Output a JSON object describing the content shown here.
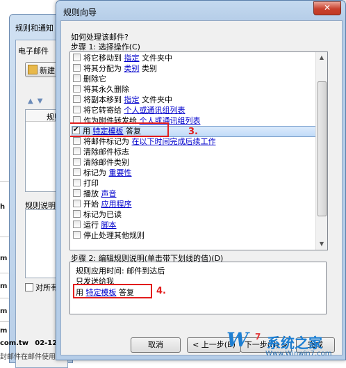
{
  "background_window": {
    "title": "规则和通知",
    "tab": "电子邮件",
    "new_button": "新建",
    "column_header": "规则",
    "description_label": "规则说明",
    "apply_all_folders": "对所有",
    "left_edge_rows": [
      "h",
      "m",
      "m",
      "m",
      "m"
    ],
    "footer_domain": "com.tw",
    "footer_time": "02-12",
    "footer_sub": "封邮件在邮件使用..."
  },
  "dialog": {
    "title": "规则向导",
    "close_glyph": "✕",
    "question": "如何处理该邮件?",
    "step1_label": "步骤 1: 选择操作(C)",
    "actions": [
      {
        "pre": "将它移动到",
        "link": "指定",
        "post": "文件夹中",
        "checked": false
      },
      {
        "pre": "将其分配为",
        "link": "类别",
        "post": "类别",
        "checked": false
      },
      {
        "pre": "删除它",
        "link": "",
        "post": "",
        "checked": false
      },
      {
        "pre": "将其永久删除",
        "link": "",
        "post": "",
        "checked": false
      },
      {
        "pre": "将副本移到",
        "link": "指定",
        "post": "文件夹中",
        "checked": false
      },
      {
        "pre": "将它转寄给",
        "link": "个人或通讯组列表",
        "post": "",
        "checked": false
      },
      {
        "pre": "作为附件转发给",
        "link": "个人或通讯组列表",
        "post": "",
        "checked": false
      },
      {
        "pre": "用",
        "link": "特定模板",
        "post": "答复",
        "checked": true
      },
      {
        "pre": "将邮件标记为",
        "link": "在以下时间完成后续工作",
        "post": "",
        "checked": false
      },
      {
        "pre": "清除邮件标志",
        "link": "",
        "post": "",
        "checked": false
      },
      {
        "pre": "清除邮件类别",
        "link": "",
        "post": "",
        "checked": false
      },
      {
        "pre": "标记为",
        "link": "重要性",
        "post": "",
        "checked": false
      },
      {
        "pre": "打印",
        "link": "",
        "post": "",
        "checked": false
      },
      {
        "pre": "播放",
        "link": "声音",
        "post": "",
        "checked": false
      },
      {
        "pre": "开始",
        "link": "应用程序",
        "post": "",
        "checked": false
      },
      {
        "pre": "标记为已读",
        "link": "",
        "post": "",
        "checked": false
      },
      {
        "pre": "运行",
        "link": "脚本",
        "post": "",
        "checked": false
      },
      {
        "pre": "停止处理其他规则",
        "link": "",
        "post": "",
        "checked": false
      }
    ],
    "annotation_3": "3.",
    "step2_label": "步骤 2: 编辑规则说明(单击带下划线的值)(D)",
    "description_lines": {
      "line1": "规则应用时间: 邮件到达后",
      "line2": "只发送给我",
      "line3_pre": "用",
      "line3_link": "特定模板",
      "line3_post": "答复"
    },
    "annotation_4": "4.",
    "buttons": {
      "cancel": "取消",
      "back": "< 上一步(B)",
      "next": "下一步(N) >",
      "finish": "完成"
    },
    "scroll_up": "▲",
    "scroll_down": "▼"
  },
  "watermark": {
    "w": "W",
    "num": "7",
    "cn": "系统之家",
    "site": "Www.Winwin7.com"
  }
}
